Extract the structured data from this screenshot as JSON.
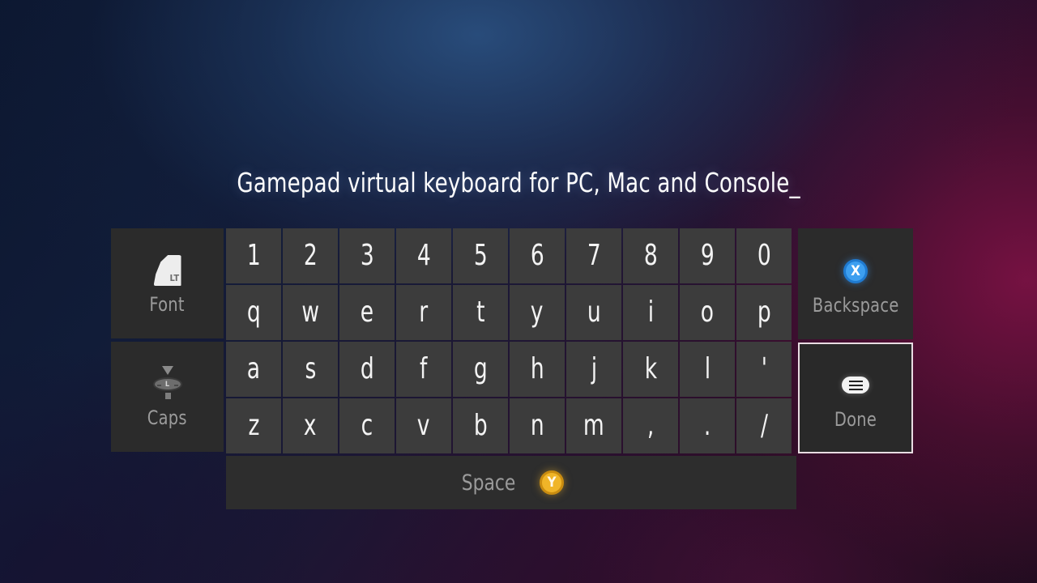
{
  "title": {
    "text": "Gamepad virtual keyboard for PC, Mac and Console_"
  },
  "colors": {
    "key_face": "#3c3c3c",
    "panel_face": "#2b2b2b",
    "key_text": "#f3f3f3",
    "label_text": "#9b9b9b",
    "focus_border": "#e8dce2",
    "x_button": "#3d9ff0",
    "y_button": "#f0b528",
    "bg_blue": "#1d3557",
    "bg_maroon": "#4a1030",
    "bg_navy": "#0e1a34"
  },
  "keyboard": {
    "rows": [
      [
        "1",
        "2",
        "3",
        "4",
        "5",
        "6",
        "7",
        "8",
        "9",
        "0"
      ],
      [
        "q",
        "w",
        "e",
        "r",
        "t",
        "y",
        "u",
        "i",
        "o",
        "p"
      ],
      [
        "a",
        "s",
        "d",
        "f",
        "g",
        "h",
        "j",
        "k",
        "l",
        "'"
      ],
      [
        "z",
        "x",
        "c",
        "v",
        "b",
        "n",
        "m",
        ",",
        ".",
        "/"
      ]
    ]
  },
  "left_panel": {
    "font": {
      "label": "Font",
      "icon": "lt-trigger-icon",
      "icon_text": "LT"
    },
    "caps": {
      "label": "Caps",
      "icon": "left-stick-icon",
      "icon_text": "L"
    }
  },
  "right_panel": {
    "backspace": {
      "label": "Backspace",
      "icon": "x-button-icon",
      "icon_text": "X",
      "focused": false
    },
    "done": {
      "label": "Done",
      "icon": "menu-button-icon",
      "focused": true
    }
  },
  "space_bar": {
    "label": "Space",
    "icon": "y-button-icon",
    "icon_text": "Y"
  }
}
